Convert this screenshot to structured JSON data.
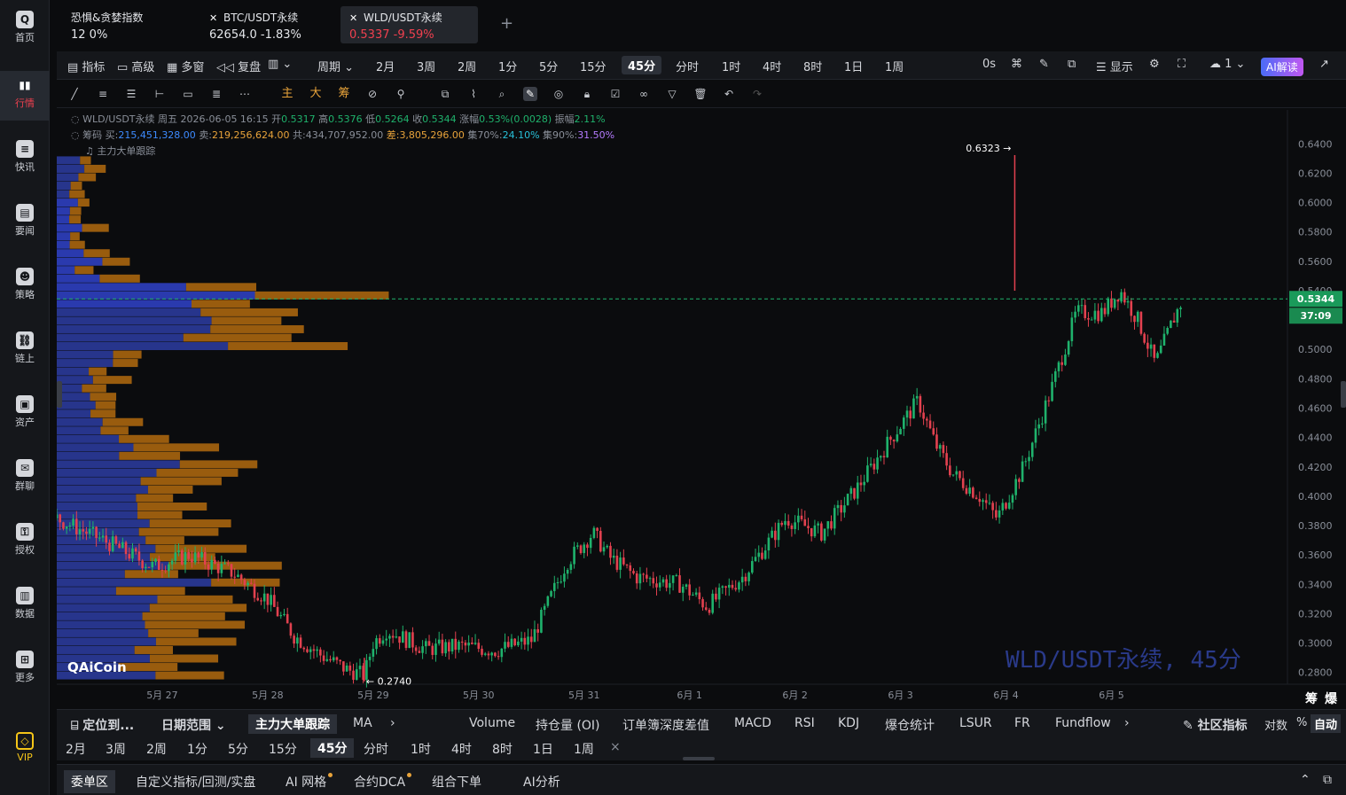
{
  "sidebar": {
    "items": [
      {
        "label": "首页",
        "icon": "home-logo-icon"
      },
      {
        "label": "行情",
        "icon": "market-chart-icon",
        "active": true
      },
      {
        "label": "快讯",
        "icon": "news-flash-icon"
      },
      {
        "label": "要闻",
        "icon": "headlines-doc-icon"
      },
      {
        "label": "策略",
        "icon": "strategy-robot-icon"
      },
      {
        "label": "链上",
        "icon": "onchain-icon"
      },
      {
        "label": "资产",
        "icon": "wallet-icon"
      },
      {
        "label": "群聊",
        "icon": "chat-icon"
      },
      {
        "label": "授权",
        "icon": "key-icon"
      },
      {
        "label": "数据",
        "icon": "data-chart-icon"
      },
      {
        "label": "更多",
        "icon": "grid-more-icon"
      }
    ],
    "vip_label": "VIP"
  },
  "tabs": [
    {
      "name": "恐惧&贪婪指数",
      "value": "12  0%"
    },
    {
      "name": "BTC/USDT永续",
      "value": "62654.0  -1.83%"
    },
    {
      "name": "WLD/USDT永续",
      "price": "0.5337",
      "change": "-9.59%",
      "active": true
    }
  ],
  "toolbar": {
    "indicator": "指标",
    "advanced": "高级",
    "multi_window": "多窗",
    "replay": "复盘",
    "period": "周期",
    "periods": [
      "2月",
      "3周",
      "2周",
      "1分",
      "5分",
      "15分",
      "45分",
      "分时",
      "1时",
      "4时",
      "8时",
      "1日",
      "1周"
    ],
    "active_period": "45分",
    "countdown_label": "0s",
    "display": "显示",
    "layout_count": "1",
    "ai_label": "AI解读"
  },
  "drawing_tools": {
    "main_label": "主",
    "big_label": "大",
    "chip_label": "筹"
  },
  "chart_info": {
    "line1_symbol": "WLD/USDT永续",
    "line1_date": "周五 2026-06-05 16:15",
    "line1_open_label": "开",
    "open": "0.5317",
    "line1_high_label": "高",
    "high": "0.5376",
    "line1_low_label": "低",
    "low": "0.5264",
    "line1_close_label": "收",
    "close": "0.5344",
    "line1_change_label": "涨幅",
    "change": "0.53%(0.0028)",
    "line1_amp_label": "振幅",
    "amplitude": "2.11%",
    "line2_chip_label": "筹码",
    "buy_label": "买:",
    "buy": "215,451,328.00",
    "sell_label": "卖:",
    "sell": "219,256,624.00",
    "total_label": "共:",
    "total": "434,707,952.00",
    "diff_label": "差:",
    "diff": "3,805,296.00",
    "c70_label": "集70%:",
    "c70": "24.10%",
    "c90_label": "集90%:",
    "c90": "31.50%",
    "line3": "主力大单跟踪"
  },
  "chart_labels": {
    "max_label": "0.6323",
    "min_label": "0.2740",
    "current_price": "0.5344",
    "countdown": "37:09",
    "watermark": "WLD/USDT永续, 45分",
    "logo": "AiCoin",
    "chip_tag": "筹",
    "burst_tag": "爆"
  },
  "chart_data": {
    "type": "candlestick",
    "symbol": "WLD/USDT永续",
    "interval": "45分",
    "y_ticks": [
      "0.6400",
      "0.6200",
      "0.6000",
      "0.5800",
      "0.5600",
      "0.5400",
      "0.5000",
      "0.4800",
      "0.4600",
      "0.4400",
      "0.4200",
      "0.4000",
      "0.3800",
      "0.3600",
      "0.3400",
      "0.3200",
      "0.3000",
      "0.2800"
    ],
    "ylim": [
      0.272,
      0.645
    ],
    "x_ticks": [
      "5月 27",
      "5月 28",
      "5月 29",
      "5月 30",
      "5月 31",
      "6月 1",
      "6月 2",
      "6月 3",
      "6月 4",
      "6月 5"
    ],
    "x_tick_dates": [
      "2026-05-27",
      "2026-05-28",
      "2026-05-29",
      "2026-05-30",
      "2026-05-31",
      "2026-06-01",
      "2026-06-02",
      "2026-06-03",
      "2026-06-04",
      "2026-06-05"
    ],
    "x_range": [
      "2026-05-26T00:00",
      "2026-06-05T16:15"
    ],
    "close_path": [
      [
        "2026-05-26T00:00",
        0.385
      ],
      [
        "2026-05-26T12:00",
        0.368
      ],
      [
        "2026-05-26T22:00",
        0.352
      ],
      [
        "2026-05-27T06:00",
        0.36
      ],
      [
        "2026-05-27T16:00",
        0.348
      ],
      [
        "2026-05-28T00:00",
        0.33
      ],
      [
        "2026-05-28T06:00",
        0.305
      ],
      [
        "2026-05-28T12:00",
        0.292
      ],
      [
        "2026-05-28T18:00",
        0.282
      ],
      [
        "2026-05-28T22:00",
        0.278
      ],
      [
        "2026-05-29T00:00",
        0.3
      ],
      [
        "2026-05-29T03:00",
        0.309
      ],
      [
        "2026-05-29T12:00",
        0.296
      ],
      [
        "2026-05-29T20:00",
        0.298
      ],
      [
        "2026-05-30T04:00",
        0.295
      ],
      [
        "2026-05-30T12:00",
        0.302
      ],
      [
        "2026-05-30T20:00",
        0.355
      ],
      [
        "2026-05-31T02:00",
        0.375
      ],
      [
        "2026-05-31T06:00",
        0.358
      ],
      [
        "2026-05-31T12:00",
        0.345
      ],
      [
        "2026-05-31T22:00",
        0.34
      ],
      [
        "2026-06-01T04:00",
        0.325
      ],
      [
        "2026-06-01T12:00",
        0.345
      ],
      [
        "2026-06-01T22:00",
        0.385
      ],
      [
        "2026-06-02T06:00",
        0.375
      ],
      [
        "2026-06-02T14:00",
        0.405
      ],
      [
        "2026-06-02T22:00",
        0.44
      ],
      [
        "2026-06-03T04:00",
        0.465
      ],
      [
        "2026-06-03T08:00",
        0.435
      ],
      [
        "2026-06-03T12:00",
        0.415
      ],
      [
        "2026-06-03T18:00",
        0.4
      ],
      [
        "2026-06-03T22:00",
        0.385
      ],
      [
        "2026-06-04T04:00",
        0.42
      ],
      [
        "2026-06-04T10:00",
        0.47
      ],
      [
        "2026-06-04T16:00",
        0.525
      ],
      [
        "2026-06-04T22:00",
        0.525
      ],
      [
        "2026-06-05T02:00",
        0.54
      ],
      [
        "2026-06-05T06:00",
        0.52
      ],
      [
        "2026-06-05T10:00",
        0.49
      ],
      [
        "2026-06-05T14:00",
        0.52
      ],
      [
        "2026-06-05T16:15",
        0.5344
      ]
    ],
    "price_high": 0.6323,
    "price_low": 0.274,
    "current_price": 0.5344
  },
  "indicator_bar": {
    "locate": "定位到...",
    "date_range": "日期范围",
    "main_track": "主力大单跟踪",
    "ma": "MA",
    "items": [
      "Volume",
      "持仓量 (OI)",
      "订单簿深度差值",
      "MACD",
      "RSI",
      "KDJ",
      "爆仓统计",
      "LSUR",
      "FR",
      "Fundflow"
    ],
    "community": "社区指标",
    "log": "对数",
    "percent": "%",
    "auto": "自动"
  },
  "period_bar2": {
    "periods": [
      "2月",
      "3周",
      "2周",
      "1分",
      "5分",
      "15分",
      "45分",
      "分时",
      "1时",
      "4时",
      "8时",
      "1日",
      "1周"
    ],
    "active": "45分",
    "close": "×"
  },
  "order_bar": {
    "items": [
      "委单区",
      "自定义指标/回测/实盘",
      "AI 网格",
      "合约DCA",
      "组合下单",
      "AI分析"
    ]
  },
  "colors": {
    "up": "#1fb26c",
    "down": "#e2414f",
    "buy_chip": "#2a35b8",
    "sell_chip": "#b36e10",
    "accent": "#f0404f",
    "price_tag": "#1a9a5a"
  }
}
